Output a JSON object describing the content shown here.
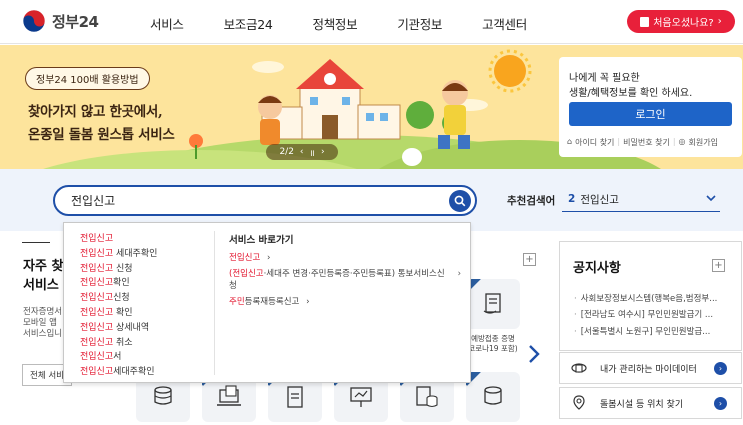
{
  "header": {
    "logo_text": "정부24",
    "nav": [
      "서비스",
      "보조금24",
      "정책정보",
      "기관정보",
      "고객센터"
    ],
    "first_visit_label": "처음오셨나요?",
    "colors": {
      "accent": "#e8203a",
      "brand": "#1e4fa8"
    }
  },
  "banner": {
    "badge": "정부24 100배 활용방법",
    "line1": "찾아가지 않고 한곳에서,",
    "line2": "온종일 돌봄 원스톱 서비스",
    "pager_text": "2/2",
    "pager_prev": "‹",
    "pager_pause": "॥",
    "pager_next": "›"
  },
  "login_panel": {
    "line1": "나에게 꼭 필요한",
    "line2": "생활/혜택정보를 확인 하세요.",
    "login_button": "로그인",
    "links": [
      "아이디 찾기",
      "비밀번호 찾기",
      "회원가입"
    ],
    "separator": "|"
  },
  "search": {
    "value": "전입신고",
    "recommend_label": "추천검색어",
    "recommend_number": "2",
    "recommend_value": "전입신고"
  },
  "left_section": {
    "title_line1": "자주 찾",
    "title_line2": "서비스",
    "desc": [
      "전자증명서",
      "모바일 앱",
      "서비스입니"
    ],
    "button": "전체 서비"
  },
  "middle": {
    "tile_caption_line1": "예방접종 증명",
    "tile_caption_line2": "코로나19 포함)"
  },
  "notice": {
    "title": "공지사항",
    "items": [
      "사회보장정보시스템(행복e음,범정부...",
      "[전라남도 여수시] 무인민원발급기 ...",
      "[서울특별시 노원구] 무인민원발급..."
    ]
  },
  "quick_links": [
    {
      "label": "내가 관리하는 마이데이터",
      "icon": "mydata-icon"
    },
    {
      "label": "돌봄시설 등 위치 찾기",
      "icon": "location-pin-icon"
    }
  ],
  "autocomplete": {
    "suggestions": [
      {
        "hl": "전입신고",
        "rest": ""
      },
      {
        "hl": "전입신고",
        "rest": " 세대주확인"
      },
      {
        "hl": "전입신고",
        "rest": " 신청"
      },
      {
        "hl": "전입신고",
        "rest": "확인"
      },
      {
        "hl": "전입신고",
        "rest": "신청"
      },
      {
        "hl": "전입신고",
        "rest": " 확인"
      },
      {
        "hl": "전입신고",
        "rest": " 상세내역"
      },
      {
        "hl": "전입신고",
        "rest": " 취소"
      },
      {
        "hl": "전입신고",
        "rest": "서"
      },
      {
        "hl": "전입신고",
        "rest": "세대주확인"
      }
    ],
    "shortcut_title": "서비스 바로가기",
    "shortcuts": [
      {
        "hl": "전입신고",
        "rest": "",
        "pre": ""
      },
      {
        "pre": "(",
        "hl": "전입신고",
        "rest": "·세대주 변경·주민등록증·주민등록표) 통보서비스신청"
      },
      {
        "pre": "",
        "hl": "주민",
        "rest": "등록재등록신고"
      }
    ],
    "arrow": "›"
  }
}
